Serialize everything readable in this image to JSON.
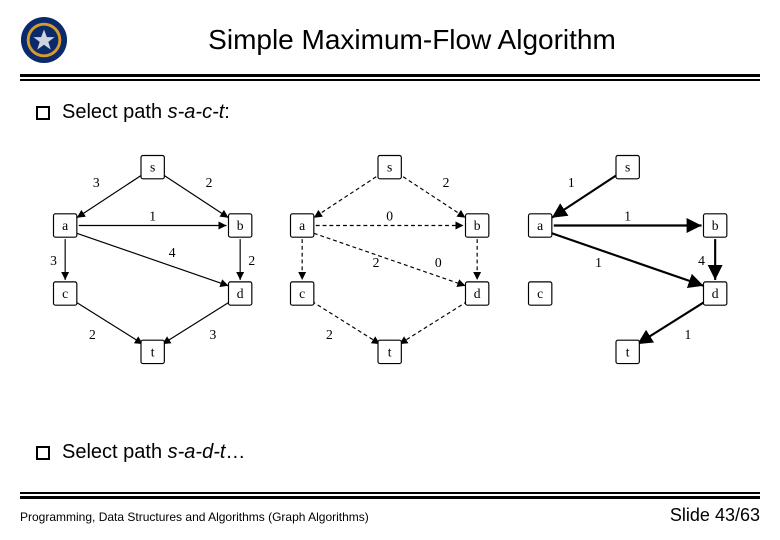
{
  "title": "Simple Maximum-Flow Algorithm",
  "bullet1": {
    "prefix": "Select path ",
    "path": "s-a-c-t",
    "suffix": ":"
  },
  "bullet2": {
    "prefix": "Select path ",
    "path": "s-a-d-t",
    "suffix": "…"
  },
  "nodes": {
    "s": "s",
    "a": "a",
    "b": "b",
    "c": "c",
    "d": "d",
    "t": "t"
  },
  "graphs": {
    "left": {
      "sa": "3",
      "sb": "2",
      "ab": "1",
      "ac": "3",
      "ad": "4",
      "bd": "2",
      "ct": "2",
      "dt": "3"
    },
    "middle": {
      "sa": "",
      "sb": "2",
      "ab": "0",
      "ac": "",
      "ad": "2",
      "bd": "0",
      "ct": "2",
      "dt": ""
    },
    "right": {
      "sa": "1",
      "ab": "1",
      "ad": "1",
      "bd": "4",
      "dt": "1"
    }
  },
  "footer": {
    "left": "Programming, Data Structures and Algorithms  (Graph Algorithms)",
    "slide_prefix": "Slide ",
    "slide_num": "43/63"
  }
}
